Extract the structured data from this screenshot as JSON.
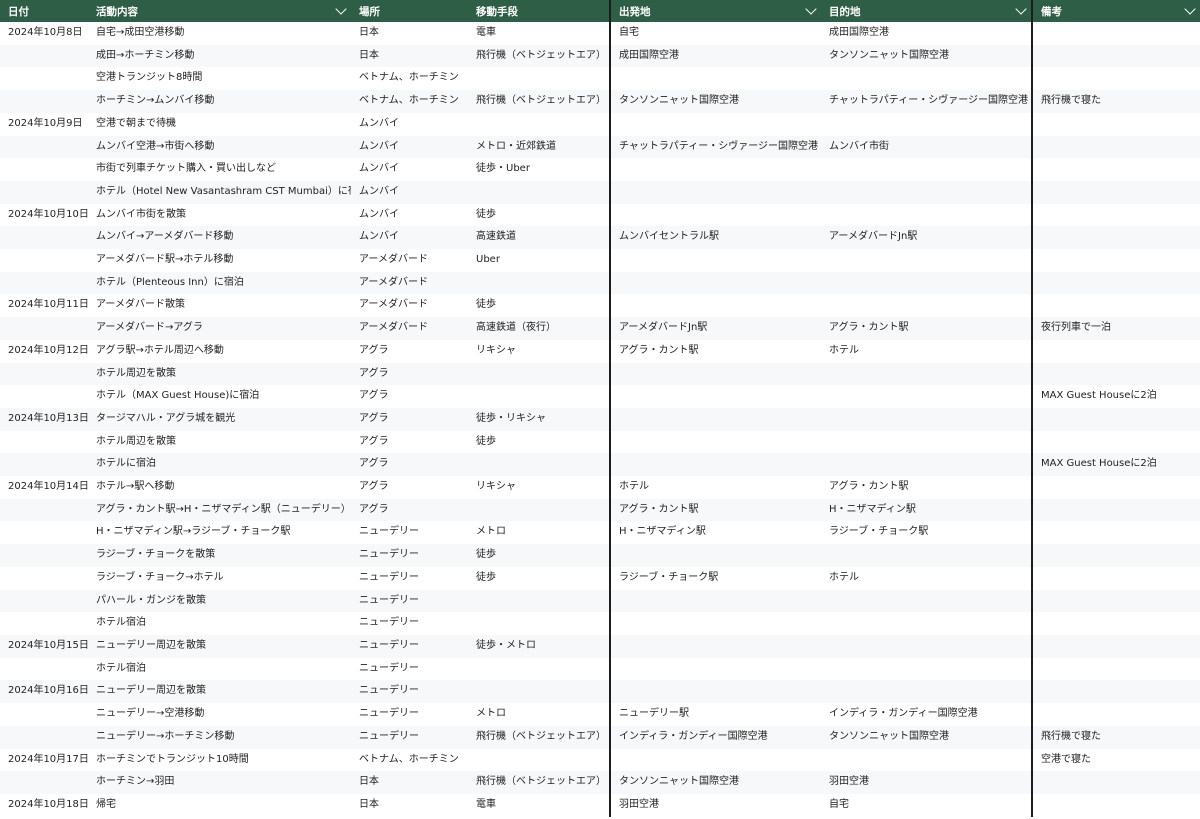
{
  "headers": [
    "日付",
    "活動内容",
    "場所",
    "移動手段",
    "出発地",
    "目的地",
    "備考"
  ],
  "rows": [
    [
      "2024年10月8日",
      "自宅→成田空港移動",
      "日本",
      "電車",
      "自宅",
      "成田国際空港",
      ""
    ],
    [
      "",
      "成田→ホーチミン移動",
      "日本",
      "飛行機（ベトジェットエア）",
      "成田国際空港",
      "タンソンニャット国際空港",
      ""
    ],
    [
      "",
      "空港トランジット8時間",
      "ベトナム、ホーチミン",
      "",
      "",
      "",
      ""
    ],
    [
      "",
      "ホーチミン→ムンバイ移動",
      "ベトナム、ホーチミン",
      "飛行機（ベトジェットエア）",
      "タンソンニャット国際空港",
      "チャットラパティー・シヴァージー国際空港",
      "飛行機で寝た"
    ],
    [
      "2024年10月9日",
      "空港で朝まで待機",
      "ムンバイ",
      "",
      "",
      "",
      ""
    ],
    [
      "",
      "ムンバイ空港→市街へ移動",
      "ムンバイ",
      "メトロ・近郊鉄道",
      "チャットラパティー・シヴァージー国際空港",
      "ムンバイ市街",
      ""
    ],
    [
      "",
      "市街で列車チケット購入・買い出しなど",
      "ムンバイ",
      "徒歩・Uber",
      "",
      "",
      ""
    ],
    [
      "",
      "ホテル（Hotel New Vasantashram CST Mumbai）に宿泊",
      "ムンバイ",
      "",
      "",
      "",
      ""
    ],
    [
      "2024年10月10日",
      "ムンバイ市街を散策",
      "ムンバイ",
      "徒歩",
      "",
      "",
      ""
    ],
    [
      "",
      "ムンバイ→アーメダバード移動",
      "ムンバイ",
      "高速鉄道",
      "ムンバイセントラル駅",
      "アーメダバードJn駅",
      ""
    ],
    [
      "",
      "アーメダバード駅→ホテル移動",
      "アーメダバード",
      "Uber",
      "",
      "",
      ""
    ],
    [
      "",
      "ホテル（Plenteous Inn）に宿泊",
      "アーメダバード",
      "",
      "",
      "",
      ""
    ],
    [
      "2024年10月11日",
      "アーメダバード散策",
      "アーメダバード",
      "徒歩",
      "",
      "",
      ""
    ],
    [
      "",
      "アーメダバード→アグラ",
      "アーメダバード",
      "高速鉄道（夜行）",
      "アーメダバードJn駅",
      "アグラ・カント駅",
      "夜行列車で一泊"
    ],
    [
      "2024年10月12日",
      "アグラ駅→ホテル周辺へ移動",
      "アグラ",
      "リキシャ",
      "アグラ・カント駅",
      "ホテル",
      ""
    ],
    [
      "",
      "ホテル周辺を散策",
      "アグラ",
      "",
      "",
      "",
      ""
    ],
    [
      "",
      "ホテル（MAX Guest House)に宿泊",
      "アグラ",
      "",
      "",
      "",
      "MAX Guest Houseに2泊"
    ],
    [
      "2024年10月13日",
      "タージマハル・アグラ城を観光",
      "アグラ",
      "徒歩・リキシャ",
      "",
      "",
      ""
    ],
    [
      "",
      "ホテル周辺を散策",
      "アグラ",
      "徒歩",
      "",
      "",
      ""
    ],
    [
      "",
      "ホテルに宿泊",
      "アグラ",
      "",
      "",
      "",
      "MAX Guest Houseに2泊"
    ],
    [
      "2024年10月14日",
      "ホテル→駅へ移動",
      "アグラ",
      "リキシャ",
      "ホテル",
      "アグラ・カント駅",
      ""
    ],
    [
      "",
      "アグラ・カント駅→H・ニザマディン駅（ニューデリー）",
      "アグラ",
      "",
      "アグラ・カント駅",
      "H・ニザマディン駅",
      ""
    ],
    [
      "",
      "H・ニザマディン駅→ラジーブ・チョーク駅",
      "ニューデリー",
      "メトロ",
      "H・ニザマディン駅",
      "ラジーブ・チョーク駅",
      ""
    ],
    [
      "",
      "ラジーブ・チョークを散策",
      "ニューデリー",
      "徒歩",
      "",
      "",
      ""
    ],
    [
      "",
      "ラジーブ・チョーク→ホテル",
      "ニューデリー",
      "徒歩",
      "ラジーブ・チョーク駅",
      "ホテル",
      ""
    ],
    [
      "",
      "パハール・ガンジを散策",
      "ニューデリー",
      "",
      "",
      "",
      ""
    ],
    [
      "",
      "ホテル宿泊",
      "ニューデリー",
      "",
      "",
      "",
      ""
    ],
    [
      "2024年10月15日",
      "ニューデリー周辺を散策",
      "ニューデリー",
      "徒歩・メトロ",
      "",
      "",
      ""
    ],
    [
      "",
      "ホテル宿泊",
      "ニューデリー",
      "",
      "",
      "",
      ""
    ],
    [
      "2024年10月16日",
      "ニューデリー周辺を散策",
      "ニューデリー",
      "",
      "",
      "",
      ""
    ],
    [
      "",
      "ニューデリー→空港移動",
      "ニューデリー",
      "メトロ",
      "ニューデリー駅",
      "インディラ・ガンディー国際空港",
      ""
    ],
    [
      "",
      "ニューデリー→ホーチミン移動",
      "ニューデリー",
      "飛行機（ベトジェットエア）",
      "インディラ・ガンディー国際空港",
      "タンソンニャット国際空港",
      "飛行機で寝た"
    ],
    [
      "2024年10月17日",
      "ホーチミンでトランジット10時間",
      "ベトナム、ホーチミン",
      "",
      "",
      "",
      "空港で寝た"
    ],
    [
      "",
      "ホーチミン→羽田",
      "日本",
      "飛行機（ベトジェットエア）",
      "タンソンニャット国際空港",
      "羽田空港",
      ""
    ],
    [
      "2024年10月18日",
      "帰宅",
      "日本",
      "電車",
      "羽田空港",
      "自宅",
      ""
    ]
  ]
}
